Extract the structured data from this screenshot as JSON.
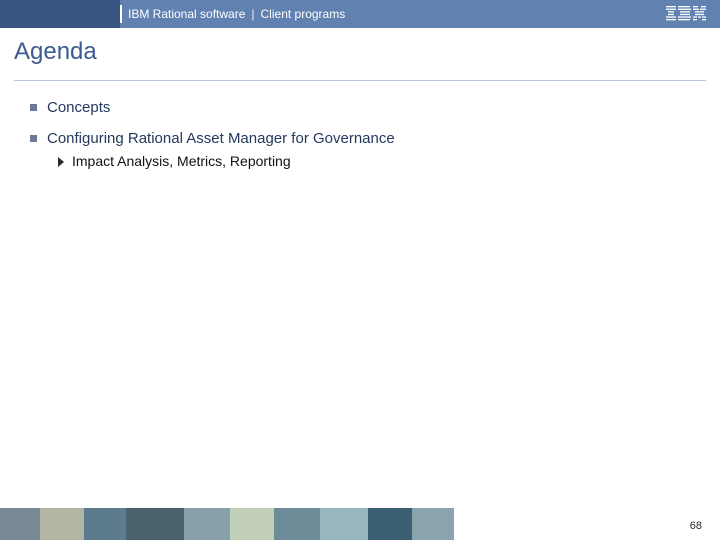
{
  "header": {
    "brand": "IBM Rational software",
    "section": "Client programs",
    "logo_label": "IBM"
  },
  "title": "Agenda",
  "bullets": [
    {
      "text": "Concepts",
      "subs": []
    },
    {
      "text": "Configuring Rational Asset Manager for Governance",
      "subs": [
        "Impact Analysis, Metrics, Reporting"
      ]
    }
  ],
  "page_number": "68"
}
